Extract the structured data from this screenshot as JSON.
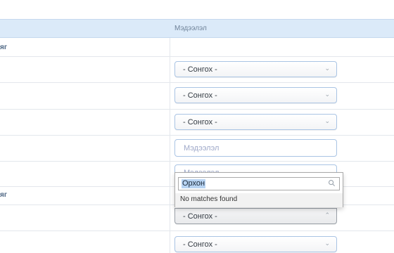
{
  "table": {
    "column_header": "Мэдээлэл",
    "section_1_label": "яг",
    "section_2_label": "яг"
  },
  "fields": {
    "select_placeholder": "- Сонгох -",
    "text_placeholder": "Мэдээлэл"
  },
  "dropdown": {
    "search_value": "Орхон",
    "no_results_text": "No matches found"
  },
  "icons": {
    "chevron": "chevron-down-icon",
    "search": "search-icon"
  }
}
